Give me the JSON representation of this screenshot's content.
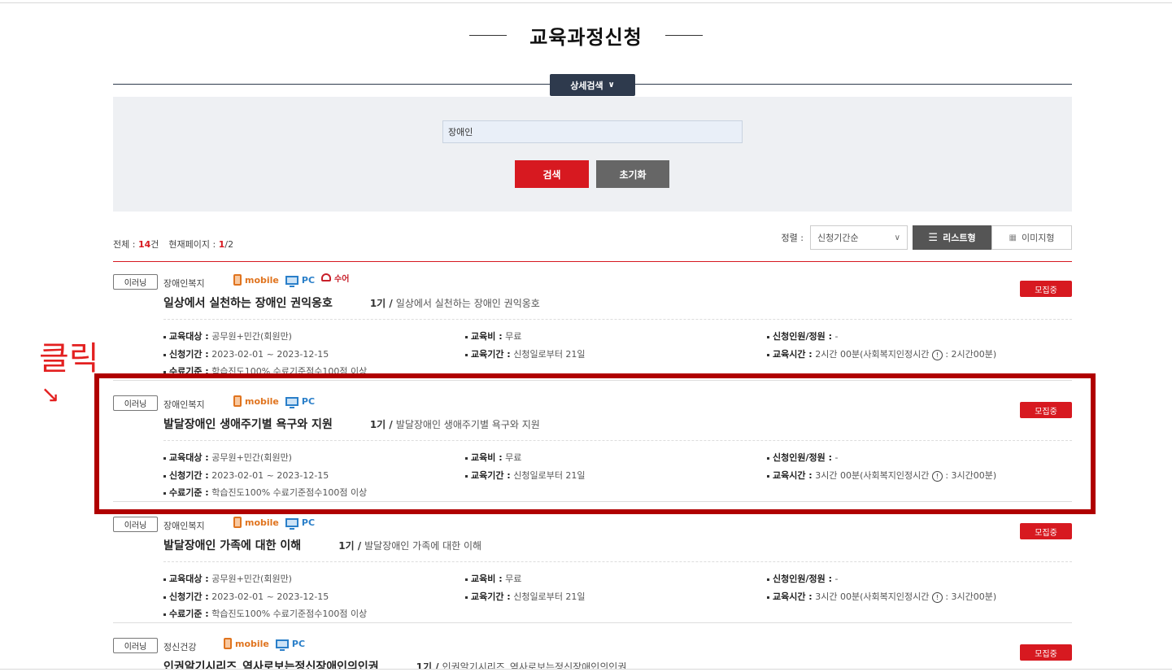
{
  "page": {
    "title": "교육과정신청"
  },
  "search": {
    "detail_label": "상세검색",
    "keyword_value": "장애인",
    "search_label": "검색",
    "reset_label": "초기화"
  },
  "summary": {
    "total_label": "전체 :",
    "total_count": "14",
    "total_unit": "건",
    "page_label": "현재페이지 :",
    "page_current": "1",
    "page_total": "/2"
  },
  "sort": {
    "label": "정렬 :",
    "selected": "신청기간순",
    "view_list_label": "리스트형",
    "view_image_label": "이미지형"
  },
  "annotation": {
    "text": "클릭",
    "arrow": "↘"
  },
  "labels": {
    "target": "교육대상 :",
    "fee": "교육비 :",
    "capacity": "신청인원/정원 :",
    "apply_period": "신청기간 :",
    "edu_period": "교육기간 :",
    "edu_time": "교육시간 :",
    "completion": "수료기준 :"
  },
  "courses": [
    {
      "tag": "이러닝",
      "category": "장애인복지",
      "mobile_label": "mobile",
      "pc_label": "PC",
      "sign_label": "수어",
      "status": "모집중",
      "title": "일상에서 실천하는 장애인 권익옹호",
      "term": "1기 /",
      "subtitle": "일상에서 실천하는 장애인 권익옹호",
      "target": "공무원+민간(회원만)",
      "fee": "무료",
      "capacity": "-",
      "apply_period": "2023-02-01 ~ 2023-12-15",
      "edu_period": "신청일로부터 21일",
      "edu_time": "2시간 00분(사회복지인정시간",
      "edu_time_suffix": ": 2시간00분)",
      "completion": "학습진도100% 수료기준점수100점 이상"
    },
    {
      "tag": "이러닝",
      "category": "장애인복지",
      "mobile_label": "mobile",
      "pc_label": "PC",
      "status": "모집중",
      "title": "발달장애인 생애주기별 욕구와 지원",
      "term": "1기 /",
      "subtitle": "발달장애인 생애주기별 욕구와 지원",
      "target": "공무원+민간(회원만)",
      "fee": "무료",
      "capacity": "-",
      "apply_period": "2023-02-01 ~ 2023-12-15",
      "edu_period": "신청일로부터 21일",
      "edu_time": "3시간 00분(사회복지인정시간",
      "edu_time_suffix": ": 3시간00분)",
      "completion": "학습진도100% 수료기준점수100점 이상"
    },
    {
      "tag": "이러닝",
      "category": "장애인복지",
      "mobile_label": "mobile",
      "pc_label": "PC",
      "status": "모집중",
      "title": "발달장애인 가족에 대한 이해",
      "term": "1기 /",
      "subtitle": "발달장애인 가족에 대한 이해",
      "target": "공무원+민간(회원만)",
      "fee": "무료",
      "capacity": "-",
      "apply_period": "2023-02-01 ~ 2023-12-15",
      "edu_period": "신청일로부터 21일",
      "edu_time": "3시간 00분(사회복지인정시간",
      "edu_time_suffix": ": 3시간00분)",
      "completion": "학습진도100% 수료기준점수100점 이상"
    },
    {
      "tag": "이러닝",
      "category": "정신건강",
      "mobile_label": "mobile",
      "pc_label": "PC",
      "status": "모집중",
      "title": "인권알기시리즈_역사로보는정신장애인의인권",
      "term": "1기 /",
      "subtitle": "인권알기시리즈_역사로보는정신장애인의인권"
    }
  ]
}
